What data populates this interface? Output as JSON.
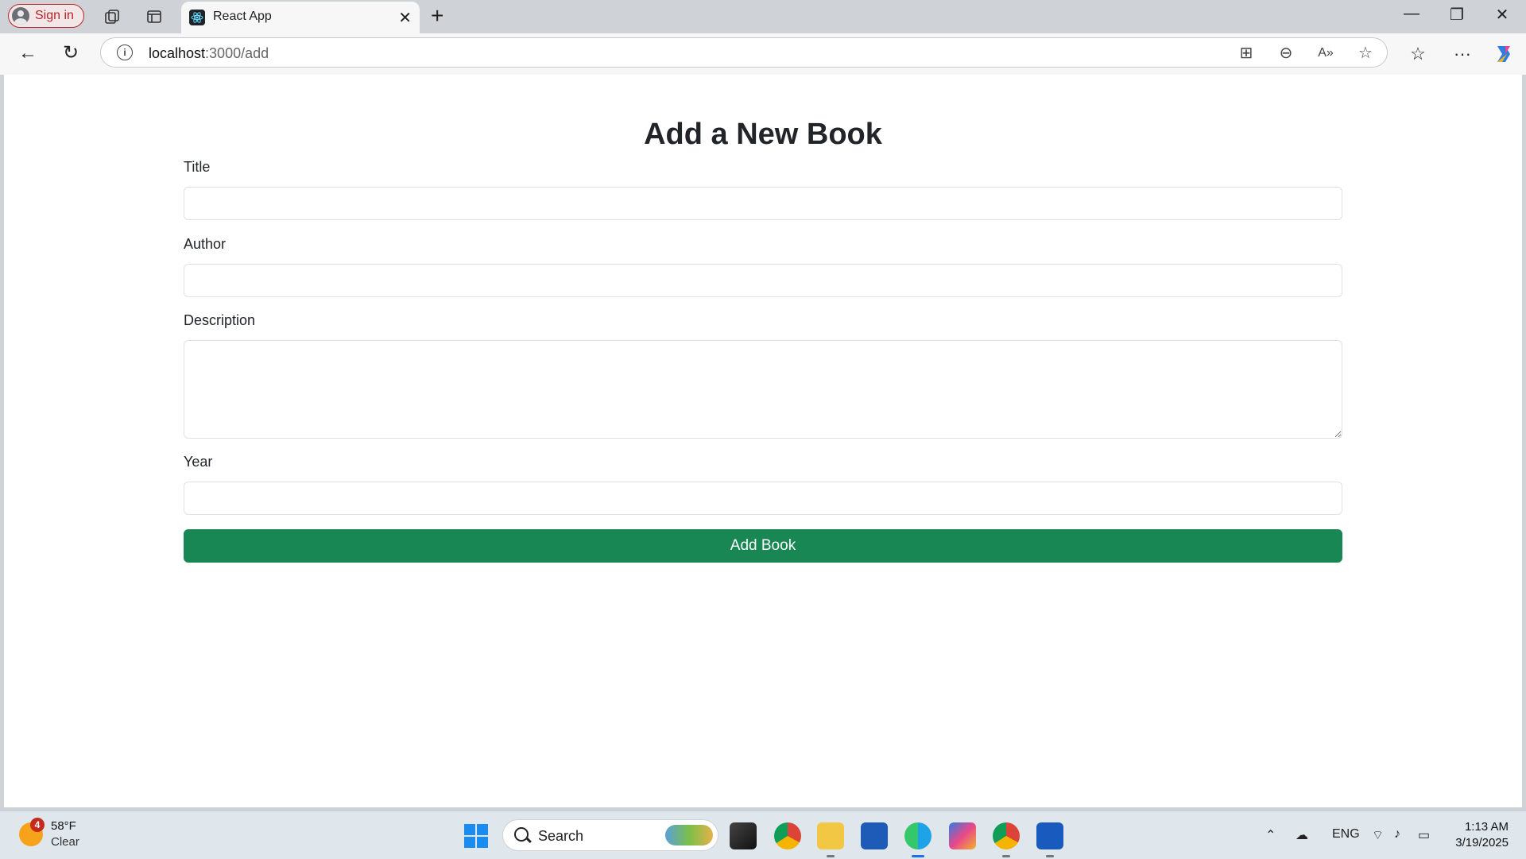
{
  "browser": {
    "signin_label": "Sign in",
    "tab_title": "React App",
    "address_host": "localhost",
    "address_path": ":3000/add"
  },
  "page": {
    "heading": "Add a New Book",
    "fields": {
      "title_label": "Title",
      "title_value": "",
      "author_label": "Author",
      "author_value": "",
      "description_label": "Description",
      "description_value": "",
      "year_label": "Year",
      "year_value": ""
    },
    "submit_label": "Add Book"
  },
  "taskbar": {
    "weather_temp": "58°F",
    "weather_condition": "Clear",
    "weather_badge": "4",
    "search_label": "Search",
    "language": "ENG",
    "time": "1:13 AM",
    "date": "3/19/2025"
  },
  "colors": {
    "submit": "#198754",
    "signin_border": "#b3262d"
  }
}
